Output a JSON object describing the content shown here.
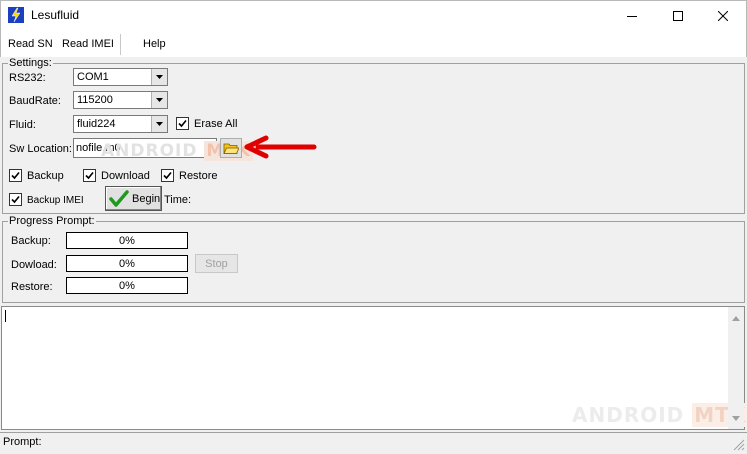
{
  "window": {
    "title": "Lesufluid",
    "app_icon": "lightning-bolt-icon",
    "controls": [
      "minimize-icon",
      "maximize-icon",
      "close-icon"
    ]
  },
  "menu": {
    "items": [
      "Read SN",
      "Read IMEI",
      "Help"
    ]
  },
  "settings": {
    "group_title": "Settings:",
    "rs232_label": "RS232:",
    "rs232_value": "COM1",
    "baudrate_label": "BaudRate:",
    "baudrate_value": "115200",
    "fluid_label": "Fluid:",
    "fluid_value": "fluid224",
    "erase_all_label": "Erase All",
    "erase_all_checked": true,
    "sw_location_label": "Sw Location:",
    "sw_location_value": "nofile.m0",
    "browse_icon": "folder-open-icon",
    "backup_label": "Backup",
    "backup_checked": true,
    "download_label": "Download",
    "download_checked": true,
    "restore_label": "Restore",
    "restore_checked": true,
    "backup_imei_label": "Backup IMEI",
    "backup_imei_checked": true,
    "begin_label": "Begin",
    "begin_icon": "green-checkmark-icon",
    "time_label": "Time:"
  },
  "progress": {
    "group_title": "Progress Prompt:",
    "backup_label": "Backup:",
    "backup_value": "0%",
    "download_label": "Dowload:",
    "download_value": "0%",
    "restore_label": "Restore:",
    "restore_value": "0%",
    "stop_label": "Stop"
  },
  "watermark": {
    "text_a": "ANDROID",
    "text_b": "MTK"
  },
  "annotation": {
    "icon": "red-arrow-icon",
    "color": "#e00000"
  },
  "status": {
    "prompt_label": "Prompt:"
  },
  "colors": {
    "check_green": "#1f9a1f",
    "folder_yellow": "#f5c518",
    "arrow_red": "#e00000"
  }
}
